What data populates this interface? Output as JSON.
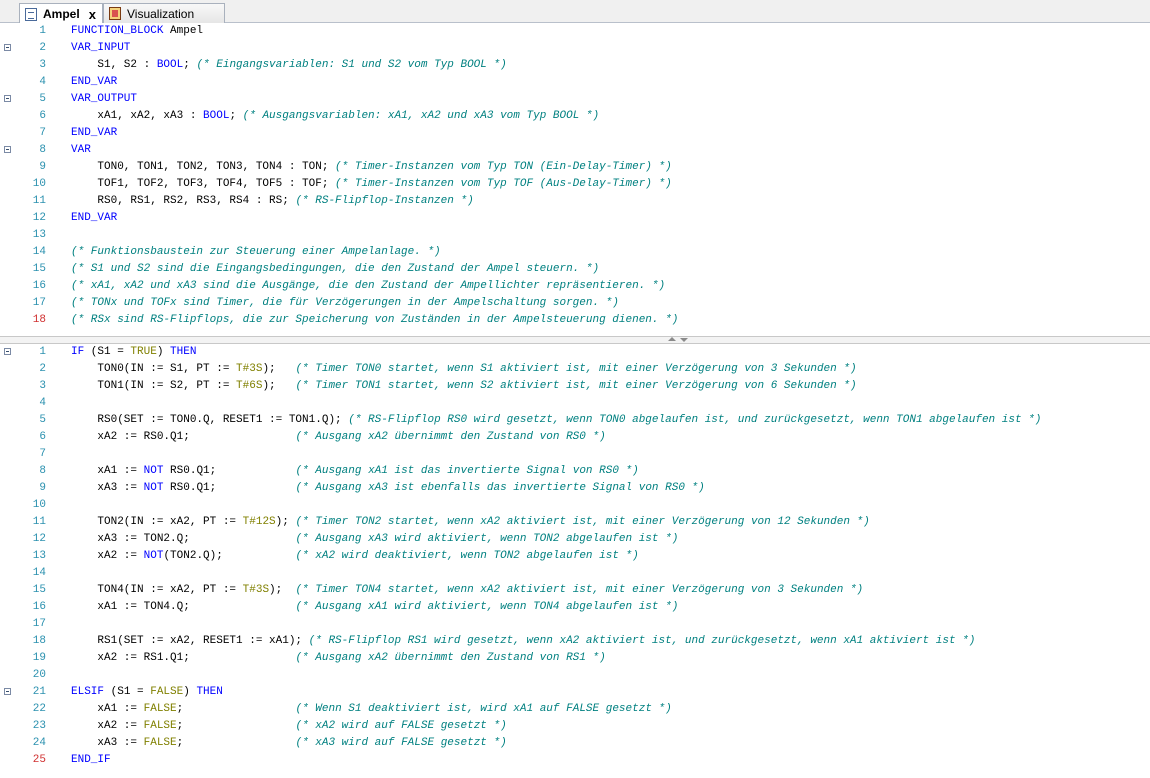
{
  "tabs": [
    {
      "label": "Ampel",
      "active": true,
      "icon": "document-icon",
      "close": "x"
    },
    {
      "label": "Visualization",
      "active": false,
      "icon": "visualization-icon"
    }
  ],
  "colors": {
    "keyword": "#0000ff",
    "literal": "#808000",
    "comment": "#008080",
    "line_number": "#2b91af",
    "marked_line_number": "#d03030"
  },
  "declaration": {
    "lines": [
      {
        "n": "1",
        "segs": [
          [
            "kw",
            "FUNCTION_BLOCK"
          ],
          [
            "p",
            " Ampel"
          ]
        ]
      },
      {
        "n": "2",
        "fold": true,
        "segs": [
          [
            "kw",
            "VAR_INPUT"
          ]
        ]
      },
      {
        "n": "3",
        "segs": [
          [
            "p",
            "    S1, S2 : "
          ],
          [
            "kw",
            "BOOL"
          ],
          [
            "p",
            "; "
          ],
          [
            "cm",
            "(* Eingangsvariablen: S1 und S2 vom Typ BOOL *)"
          ]
        ]
      },
      {
        "n": "4",
        "segs": [
          [
            "kw",
            "END_VAR"
          ]
        ]
      },
      {
        "n": "5",
        "fold": true,
        "segs": [
          [
            "kw",
            "VAR_OUTPUT"
          ]
        ]
      },
      {
        "n": "6",
        "segs": [
          [
            "p",
            "    xA1, xA2, xA3 : "
          ],
          [
            "kw",
            "BOOL"
          ],
          [
            "p",
            "; "
          ],
          [
            "cm",
            "(* Ausgangsvariablen: xA1, xA2 und xA3 vom Typ BOOL *)"
          ]
        ]
      },
      {
        "n": "7",
        "segs": [
          [
            "kw",
            "END_VAR"
          ]
        ]
      },
      {
        "n": "8",
        "fold": true,
        "segs": [
          [
            "kw",
            "VAR"
          ]
        ]
      },
      {
        "n": "9",
        "segs": [
          [
            "p",
            "    TON0, TON1, TON2, TON3, TON4 : TON; "
          ],
          [
            "cm",
            "(* Timer-Instanzen vom Typ TON (Ein-Delay-Timer) *)"
          ]
        ]
      },
      {
        "n": "10",
        "segs": [
          [
            "p",
            "    TOF1, TOF2, TOF3, TOF4, TOF5 : TOF; "
          ],
          [
            "cm",
            "(* Timer-Instanzen vom Typ TOF (Aus-Delay-Timer) *)"
          ]
        ]
      },
      {
        "n": "11",
        "segs": [
          [
            "p",
            "    RS0, RS1, RS2, RS3, RS4 : RS; "
          ],
          [
            "cm",
            "(* RS-Flipflop-Instanzen *)"
          ]
        ]
      },
      {
        "n": "12",
        "segs": [
          [
            "kw",
            "END_VAR"
          ]
        ]
      },
      {
        "n": "13",
        "segs": []
      },
      {
        "n": "14",
        "segs": [
          [
            "cm",
            "(* Funktionsbaustein zur Steuerung einer Ampelanlage. *)"
          ]
        ]
      },
      {
        "n": "15",
        "segs": [
          [
            "cm",
            "(* S1 und S2 sind die Eingangsbedingungen, die den Zustand der Ampel steuern. *)"
          ]
        ]
      },
      {
        "n": "16",
        "segs": [
          [
            "cm",
            "(* xA1, xA2 und xA3 sind die Ausgänge, die den Zustand der Ampellichter repräsentieren. *)"
          ]
        ]
      },
      {
        "n": "17",
        "segs": [
          [
            "cm",
            "(* TONx und TOFx sind Timer, die für Verzögerungen in der Ampelschaltung sorgen. *)"
          ]
        ]
      },
      {
        "n": "18",
        "mark": true,
        "segs": [
          [
            "cm",
            "(* RSx sind RS-Flipflops, die zur Speicherung von Zuständen in der Ampelsteuerung dienen. *)"
          ]
        ]
      }
    ]
  },
  "implementation": {
    "lines": [
      {
        "n": "1",
        "fold": true,
        "segs": [
          [
            "kw",
            "IF"
          ],
          [
            "p",
            " (S1 = "
          ],
          [
            "lit",
            "TRUE"
          ],
          [
            "p",
            ") "
          ],
          [
            "kw",
            "THEN"
          ]
        ]
      },
      {
        "n": "2",
        "segs": [
          [
            "p",
            "    TON0(IN := S1, PT := "
          ],
          [
            "lit",
            "T#3S"
          ],
          [
            "p",
            ");   "
          ],
          [
            "cm",
            "(* Timer TON0 startet, wenn S1 aktiviert ist, mit einer Verzögerung von 3 Sekunden *)"
          ]
        ]
      },
      {
        "n": "3",
        "segs": [
          [
            "p",
            "    TON1(IN := S2, PT := "
          ],
          [
            "lit",
            "T#6S"
          ],
          [
            "p",
            ");   "
          ],
          [
            "cm",
            "(* Timer TON1 startet, wenn S2 aktiviert ist, mit einer Verzögerung von 6 Sekunden *)"
          ]
        ]
      },
      {
        "n": "4",
        "segs": []
      },
      {
        "n": "5",
        "segs": [
          [
            "p",
            "    RS0(SET := TON0.Q, RESET1 := TON1.Q); "
          ],
          [
            "cm",
            "(* RS-Flipflop RS0 wird gesetzt, wenn TON0 abgelaufen ist, und zurückgesetzt, wenn TON1 abgelaufen ist *)"
          ]
        ]
      },
      {
        "n": "6",
        "segs": [
          [
            "p",
            "    xA2 := RS0.Q1;                "
          ],
          [
            "cm",
            "(* Ausgang xA2 übernimmt den Zustand von RS0 *)"
          ]
        ]
      },
      {
        "n": "7",
        "segs": []
      },
      {
        "n": "8",
        "segs": [
          [
            "p",
            "    xA1 := "
          ],
          [
            "kw",
            "NOT"
          ],
          [
            "p",
            " RS0.Q1;            "
          ],
          [
            "cm",
            "(* Ausgang xA1 ist das invertierte Signal von RS0 *)"
          ]
        ]
      },
      {
        "n": "9",
        "segs": [
          [
            "p",
            "    xA3 := "
          ],
          [
            "kw",
            "NOT"
          ],
          [
            "p",
            " RS0.Q1;            "
          ],
          [
            "cm",
            "(* Ausgang xA3 ist ebenfalls das invertierte Signal von RS0 *)"
          ]
        ]
      },
      {
        "n": "10",
        "segs": []
      },
      {
        "n": "11",
        "segs": [
          [
            "p",
            "    TON2(IN := xA2, PT := "
          ],
          [
            "lit",
            "T#12S"
          ],
          [
            "p",
            "); "
          ],
          [
            "cm",
            "(* Timer TON2 startet, wenn xA2 aktiviert ist, mit einer Verzögerung von 12 Sekunden *)"
          ]
        ]
      },
      {
        "n": "12",
        "segs": [
          [
            "p",
            "    xA3 := TON2.Q;                "
          ],
          [
            "cm",
            "(* Ausgang xA3 wird aktiviert, wenn TON2 abgelaufen ist *)"
          ]
        ]
      },
      {
        "n": "13",
        "segs": [
          [
            "p",
            "    xA2 := "
          ],
          [
            "kw",
            "NOT"
          ],
          [
            "p",
            "(TON2.Q);           "
          ],
          [
            "cm",
            "(* xA2 wird deaktiviert, wenn TON2 abgelaufen ist *)"
          ]
        ]
      },
      {
        "n": "14",
        "segs": []
      },
      {
        "n": "15",
        "segs": [
          [
            "p",
            "    TON4(IN := xA2, PT := "
          ],
          [
            "lit",
            "T#3S"
          ],
          [
            "p",
            ");  "
          ],
          [
            "cm",
            "(* Timer TON4 startet, wenn xA2 aktiviert ist, mit einer Verzögerung von 3 Sekunden *)"
          ]
        ]
      },
      {
        "n": "16",
        "segs": [
          [
            "p",
            "    xA1 := TON4.Q;                "
          ],
          [
            "cm",
            "(* Ausgang xA1 wird aktiviert, wenn TON4 abgelaufen ist *)"
          ]
        ]
      },
      {
        "n": "17",
        "segs": []
      },
      {
        "n": "18",
        "segs": [
          [
            "p",
            "    RS1(SET := xA2, RESET1 := xA1); "
          ],
          [
            "cm",
            "(* RS-Flipflop RS1 wird gesetzt, wenn xA2 aktiviert ist, und zurückgesetzt, wenn xA1 aktiviert ist *)"
          ]
        ]
      },
      {
        "n": "19",
        "segs": [
          [
            "p",
            "    xA2 := RS1.Q1;                "
          ],
          [
            "cm",
            "(* Ausgang xA2 übernimmt den Zustand von RS1 *)"
          ]
        ]
      },
      {
        "n": "20",
        "segs": []
      },
      {
        "n": "21",
        "fold": true,
        "segs": [
          [
            "kw",
            "ELSIF"
          ],
          [
            "p",
            " (S1 = "
          ],
          [
            "lit",
            "FALSE"
          ],
          [
            "p",
            ") "
          ],
          [
            "kw",
            "THEN"
          ]
        ]
      },
      {
        "n": "22",
        "segs": [
          [
            "p",
            "    xA1 := "
          ],
          [
            "lit",
            "FALSE"
          ],
          [
            "p",
            ";                 "
          ],
          [
            "cm",
            "(* Wenn S1 deaktiviert ist, wird xA1 auf FALSE gesetzt *)"
          ]
        ]
      },
      {
        "n": "23",
        "segs": [
          [
            "p",
            "    xA2 := "
          ],
          [
            "lit",
            "FALSE"
          ],
          [
            "p",
            ";                 "
          ],
          [
            "cm",
            "(* xA2 wird auf FALSE gesetzt *)"
          ]
        ]
      },
      {
        "n": "24",
        "segs": [
          [
            "p",
            "    xA3 := "
          ],
          [
            "lit",
            "FALSE"
          ],
          [
            "p",
            ";                 "
          ],
          [
            "cm",
            "(* xA3 wird auf FALSE gesetzt *)"
          ]
        ]
      },
      {
        "n": "25",
        "mark": true,
        "segs": [
          [
            "kw",
            "END_IF"
          ]
        ]
      }
    ]
  }
}
